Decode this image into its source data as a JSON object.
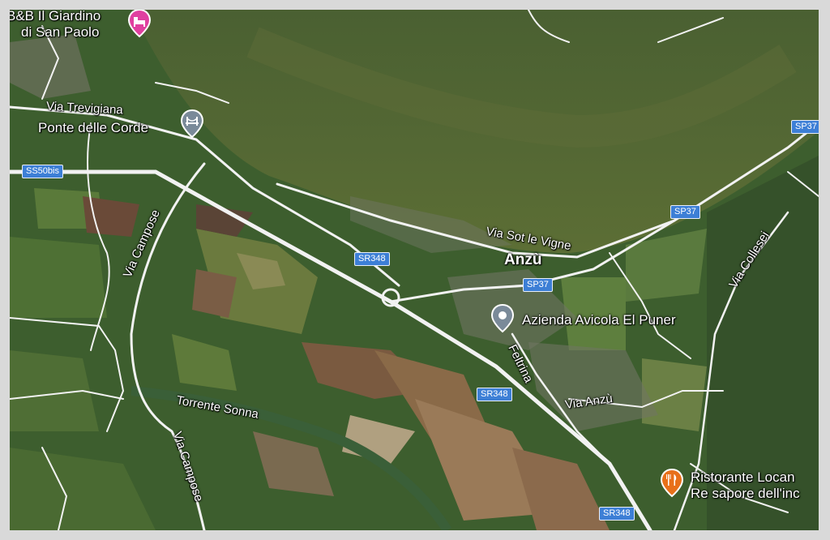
{
  "pois": {
    "bnb": {
      "line1": "B&B Il Giardino",
      "line2": "di San Paolo",
      "icon": "bed-icon",
      "color": "#e040a0"
    },
    "ponte": {
      "label": "Ponte delle Corde",
      "icon": "bridge-icon",
      "color": "#7a8a99"
    },
    "azienda": {
      "label": "Azienda Avicola El Puner",
      "icon": "location-pin-icon",
      "color": "#7a8a99"
    },
    "ristorante": {
      "line1": "Ristorante Locan",
      "line2": "Re sapore dell'inc",
      "icon": "fork-knife-icon",
      "color": "#e8701a"
    }
  },
  "places": {
    "anzu": "Anzù"
  },
  "roads": {
    "via_trevigiana": "Via Trevigiana",
    "via_campose_north": "Via Campose",
    "via_campose_south": "Via Campose",
    "via_sot_le_vigne": "Via Sot le Vigne",
    "via_collesei": "Via Collesei",
    "feltrina": "Feltrina",
    "via_anzu": "Via Anzù",
    "torrente_sonna": "Torrente Sonna"
  },
  "shields": {
    "ss50bis": "SS50bis",
    "sr348_a": "SR348",
    "sr348_b": "SR348",
    "sr348_c": "SR348",
    "sp37_a": "SP37",
    "sp37_b": "SP37",
    "sp37_c": "SP37"
  }
}
